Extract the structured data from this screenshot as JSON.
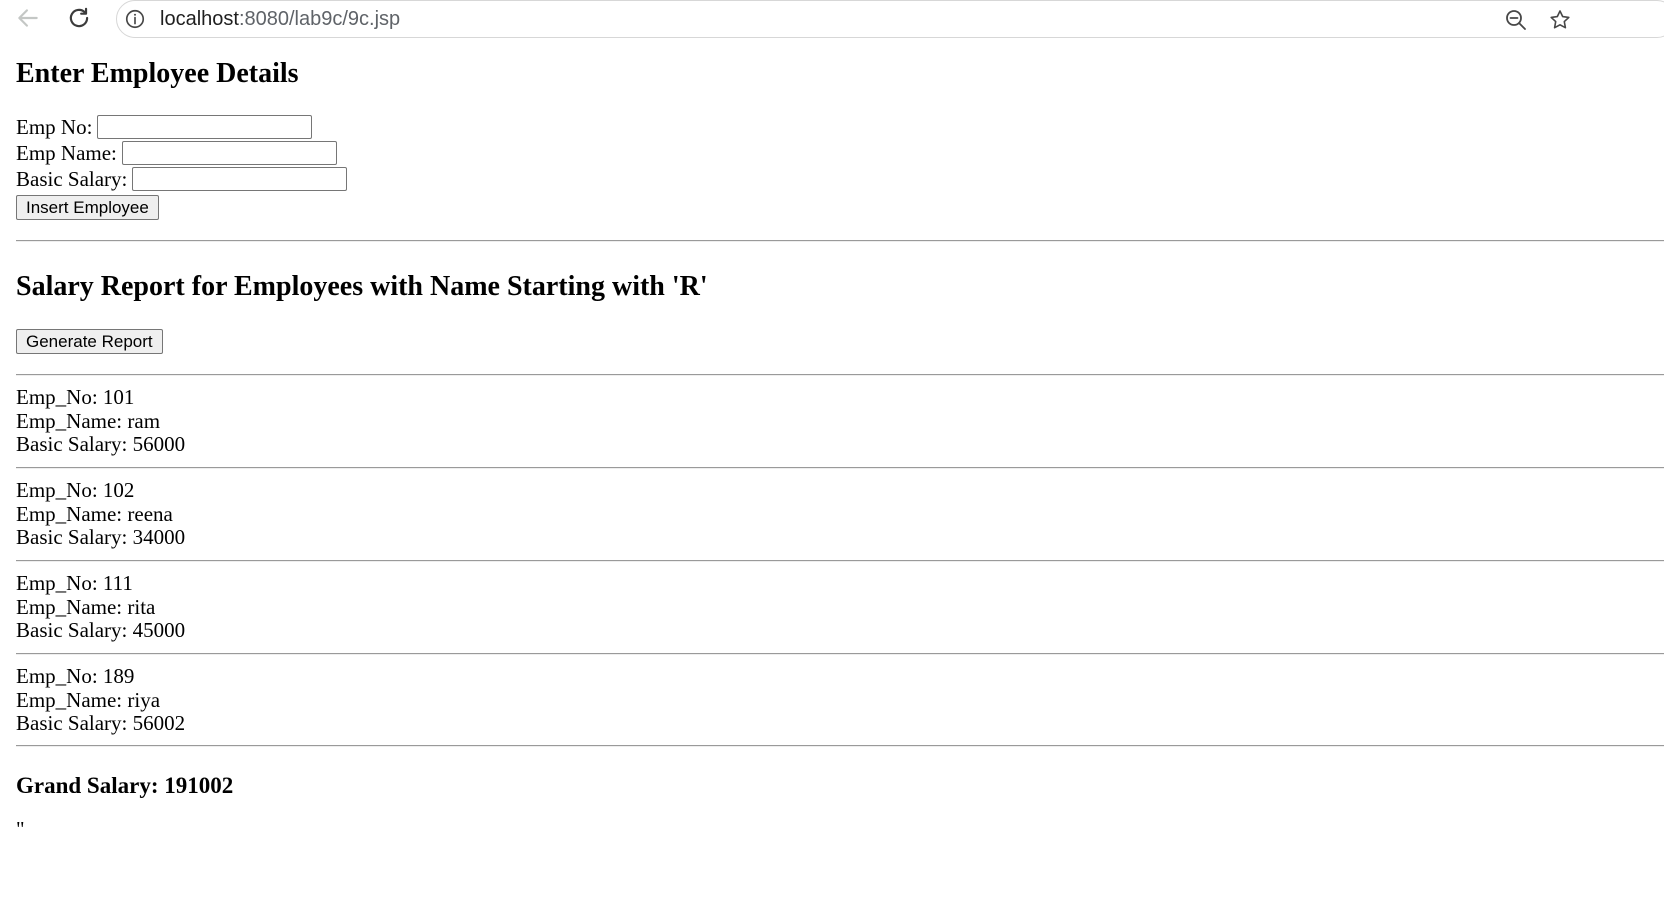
{
  "browser": {
    "url_host": "localhost",
    "url_rest": ":8080/lab9c/9c.jsp"
  },
  "insert_section": {
    "title": "Enter Employee Details",
    "fields": [
      {
        "label": "Emp No:",
        "value": ""
      },
      {
        "label": "Emp Name:",
        "value": ""
      },
      {
        "label": "Basic Salary:",
        "value": ""
      }
    ],
    "submit_label": "Insert Employee"
  },
  "report_section": {
    "title": "Salary Report for Employees with Name Starting with 'R'",
    "button_label": "Generate Report",
    "records": [
      {
        "no": "Emp_No: 101",
        "name": "Emp_Name: ram",
        "salary": "Basic Salary: 56000"
      },
      {
        "no": "Emp_No: 102",
        "name": "Emp_Name: reena",
        "salary": "Basic Salary: 34000"
      },
      {
        "no": "Emp_No: 111",
        "name": "Emp_Name: rita",
        "salary": "Basic Salary: 45000"
      },
      {
        "no": "Emp_No: 189",
        "name": "Emp_Name: riya",
        "salary": "Basic Salary: 56002"
      }
    ],
    "grand_total": "Grand Salary: 191002",
    "trailing_text": "\""
  },
  "icons": {
    "back": "back-arrow-icon",
    "reload": "reload-icon",
    "site_info": "info-icon",
    "zoom": "zoom-out-icon",
    "bookmark": "star-icon"
  }
}
